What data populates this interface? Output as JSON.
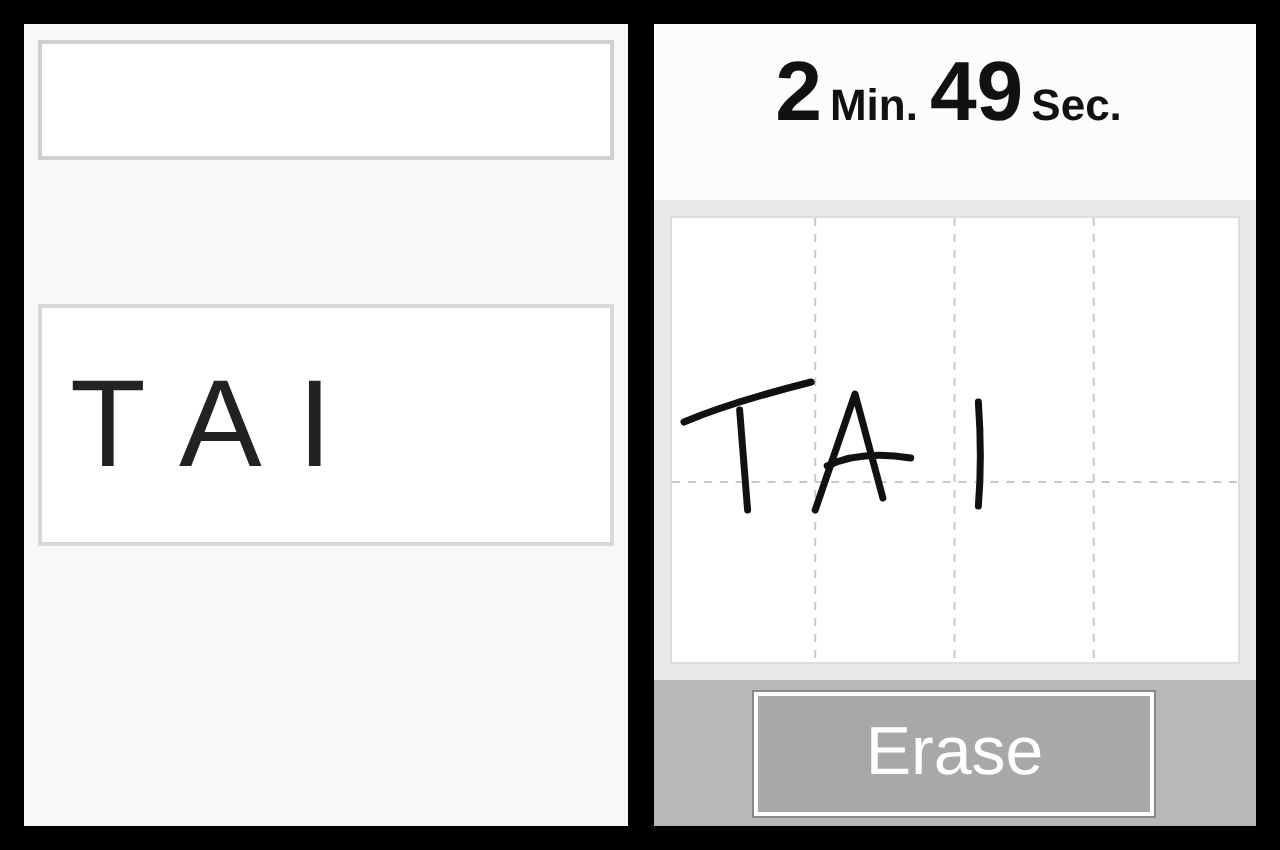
{
  "top_screen": {
    "word": "T A I"
  },
  "bottom_screen": {
    "timer": {
      "minutes": "2",
      "minutes_unit": "Min.",
      "seconds": "49",
      "seconds_unit": "Sec."
    },
    "erase_button": "Erase"
  }
}
